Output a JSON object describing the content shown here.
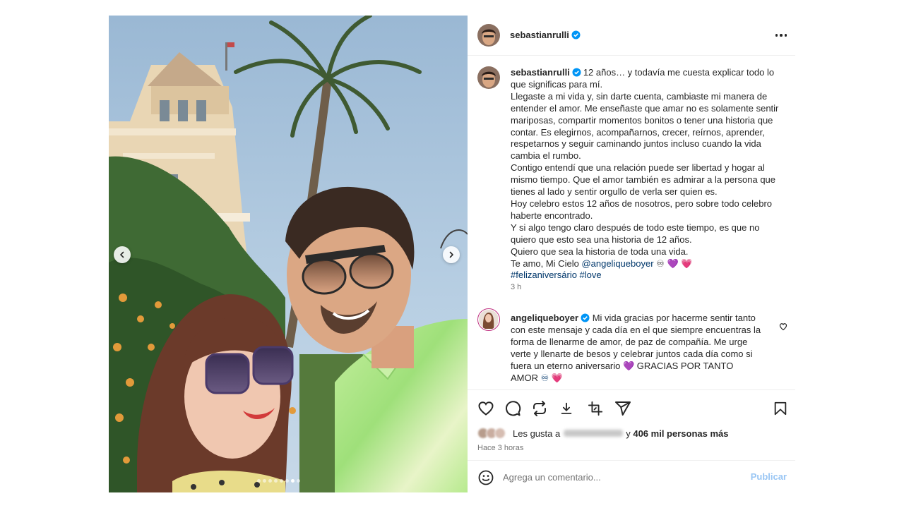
{
  "post": {
    "author": "sebastianrulli",
    "carousel": {
      "slide_count": 8,
      "active_index": 6
    }
  },
  "caption": {
    "username": "sebastianrulli",
    "lines": [
      "12 años… y todavía me cuesta explicar todo lo que significas para mí.",
      "Llegaste a mi vida y, sin darte cuenta, cambiaste mi manera de entender el amor. Me enseñaste que amar no es solamente sentir mariposas, compartir momentos bonitos o tener una historia que contar. Es elegirnos, acompañarnos, crecer, reírnos, aprender, respetarnos y seguir caminando juntos incluso cuando la vida cambia el rumbo.",
      "Contigo entendí que una relación puede ser libertad y hogar al mismo tiempo. Que el amor también es admirar a la persona que tienes al lado y sentir orgullo de verla ser quien es.",
      "Hoy celebro estos 12 años de nosotros, pero sobre todo celebro haberte encontrado.",
      "Y si algo tengo claro después de todo este tiempo, es que no quiero que esto sea una historia de 12 años.",
      "Quiero que sea la historia de toda una vida."
    ],
    "closing_text": "Te amo, Mi Cielo",
    "mention": "@angeliqueboyer",
    "closing_emojis": "♾ 💜 💗",
    "hashtags": "#felizaniversário #love",
    "time": "3 h"
  },
  "comment": {
    "username": "angeliqueboyer",
    "text": "Mi vida gracias por hacerme sentir tanto con este mensaje y cada día en el que siempre encuentras la forma de llenarme de amor, de paz de compañía. Me urge verte y llenarte de besos y celebrar juntos cada día como si fuera un eterno aniversario 💜 GRACIAS POR TANTO AMOR",
    "emojis": "♾ 💗"
  },
  "likes": {
    "prefix": "Les gusta a",
    "connector": "y",
    "count_text": "406 mil personas más",
    "time": "Hace 3 horas"
  },
  "add_comment": {
    "placeholder": "Agrega un comentario...",
    "publish_label": "Publicar"
  },
  "colors": {
    "verified": "#0095f6",
    "link": "#00376b",
    "secondary_text": "#737373",
    "publish_disabled": "#99c6f4"
  },
  "icons": [
    "verified-badge-icon",
    "more-options-icon",
    "chevron-left-icon",
    "chevron-right-icon",
    "heart-icon",
    "comment-icon",
    "repost-icon",
    "download-icon",
    "crop-icon",
    "share-icon",
    "bookmark-icon",
    "emoji-icon"
  ]
}
